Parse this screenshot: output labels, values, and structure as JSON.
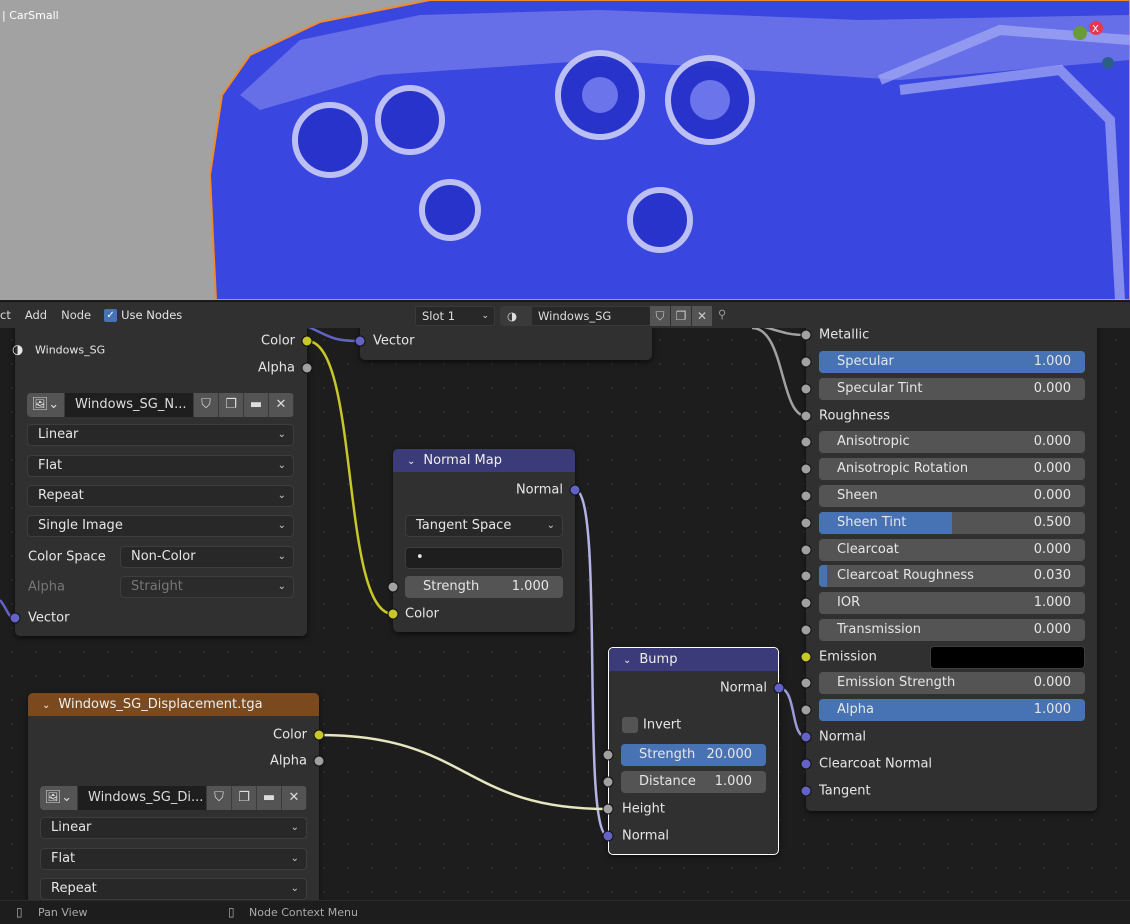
{
  "viewport": {
    "object_label": "| CarSmall"
  },
  "header": {
    "menu": [
      "ct",
      "Add",
      "Node"
    ],
    "use_nodes_label": "Use Nodes",
    "use_nodes_checked": true,
    "slot": "Slot 1",
    "material": "Windows_SG"
  },
  "nodes": {
    "image1": {
      "material_label": "Windows_SG",
      "outputs": [
        "Color",
        "Alpha"
      ],
      "image_name": "Windows_SG_N...",
      "interpolation": "Linear",
      "projection": "Flat",
      "extension": "Repeat",
      "source": "Single Image",
      "color_space_label": "Color Space",
      "color_space": "Non-Color",
      "alpha_label": "Alpha",
      "alpha_mode": "Straight",
      "input": "Vector"
    },
    "mapping": {
      "input": "Vector"
    },
    "normal_map": {
      "title": "Normal Map",
      "output": "Normal",
      "space": "Tangent Space",
      "uv": "•",
      "strength_label": "Strength",
      "strength": "1.000",
      "input": "Color"
    },
    "bump": {
      "title": "Bump",
      "output": "Normal",
      "invert_label": "Invert",
      "invert_checked": false,
      "strength_label": "Strength",
      "strength": "20.000",
      "distance_label": "Distance",
      "distance": "1.000",
      "inputs": [
        "Height",
        "Normal"
      ]
    },
    "image2": {
      "title": "Windows_SG_Displacement.tga",
      "outputs": [
        "Color",
        "Alpha"
      ],
      "image_name": "Windows_SG_Di...",
      "interpolation": "Linear",
      "projection": "Flat",
      "extension": "Repeat"
    },
    "bsdf": {
      "rows": [
        {
          "label": "Metallic",
          "type": "socket"
        },
        {
          "label": "Specular",
          "type": "slider",
          "value": "1.000",
          "fill": 1.0
        },
        {
          "label": "Specular Tint",
          "type": "slider",
          "value": "0.000",
          "fill": 0
        },
        {
          "label": "Roughness",
          "type": "socket"
        },
        {
          "label": "Anisotropic",
          "type": "slider",
          "value": "0.000",
          "fill": 0
        },
        {
          "label": "Anisotropic Rotation",
          "type": "slider",
          "value": "0.000",
          "fill": 0
        },
        {
          "label": "Sheen",
          "type": "slider",
          "value": "0.000",
          "fill": 0
        },
        {
          "label": "Sheen Tint",
          "type": "slider",
          "value": "0.500",
          "fill": 0.5
        },
        {
          "label": "Clearcoat",
          "type": "slider",
          "value": "0.000",
          "fill": 0
        },
        {
          "label": "Clearcoat Roughness",
          "type": "slider",
          "value": "0.030",
          "fill": 0.03
        },
        {
          "label": "IOR",
          "type": "slider",
          "value": "1.000",
          "fill": 0
        },
        {
          "label": "Transmission",
          "type": "slider",
          "value": "0.000",
          "fill": 0
        },
        {
          "label": "Emission",
          "type": "color",
          "color": "#000000"
        },
        {
          "label": "Emission Strength",
          "type": "slider",
          "value": "0.000",
          "fill": 0
        },
        {
          "label": "Alpha",
          "type": "slider",
          "value": "1.000",
          "fill": 1.0
        },
        {
          "label": "Normal",
          "type": "vsocket"
        },
        {
          "label": "Clearcoat Normal",
          "type": "vsocket"
        },
        {
          "label": "Tangent",
          "type": "vsocket"
        }
      ]
    }
  },
  "status_bar": {
    "items": [
      "Pan View",
      "Node Context Menu"
    ]
  },
  "colors": {
    "accent": "#4772b3",
    "socket_color": "#c7c729",
    "socket_float": "#a1a1a1",
    "socket_vector": "#6363c7",
    "vector_header": "#3b3b7a",
    "texture_header": "#7a4a1e",
    "mesh_blue": "#3a48e0",
    "selection_outline": "#f08a2a"
  }
}
